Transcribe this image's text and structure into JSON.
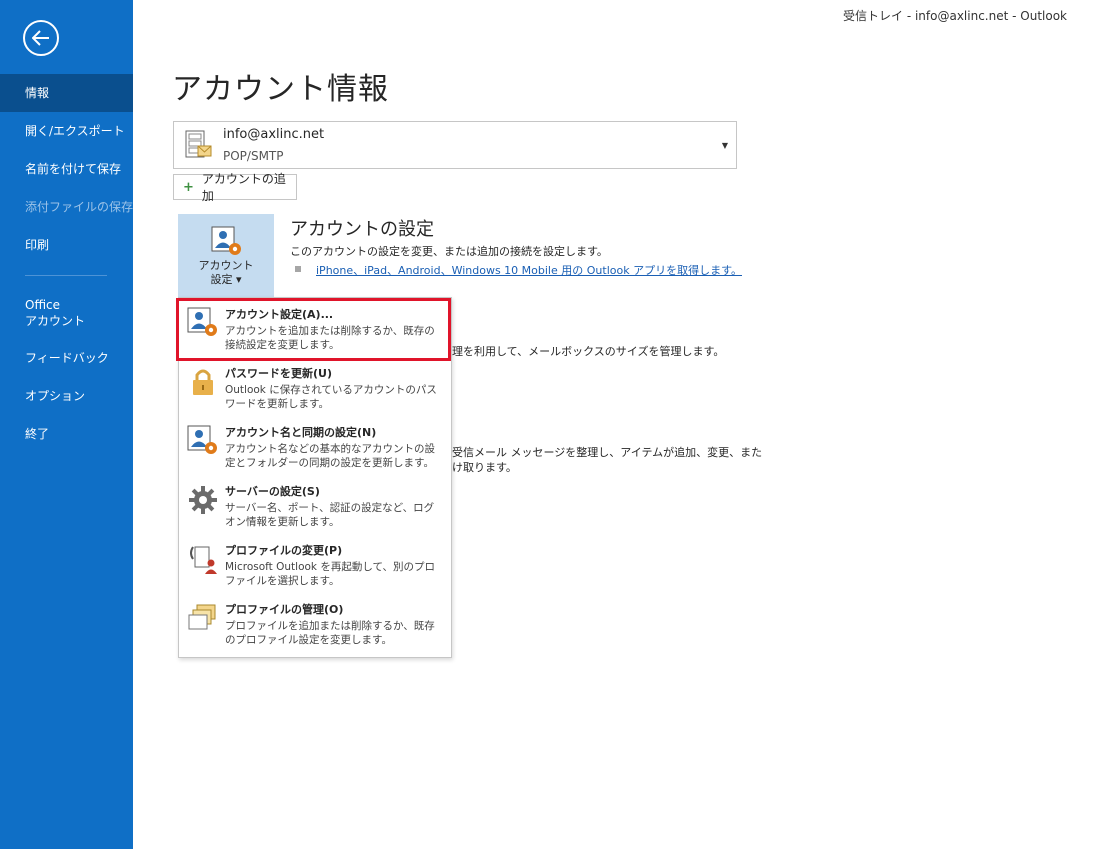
{
  "window": {
    "title": "受信トレイ - info@axlinc.net  -  Outlook"
  },
  "sidebar": {
    "items": [
      {
        "label": "情報",
        "active": true
      },
      {
        "label": "開く/エクスポート"
      },
      {
        "label": "名前を付けて保存"
      },
      {
        "label": "添付ファイルの保存",
        "disabled": true
      },
      {
        "label": "印刷"
      },
      {
        "label": "Office\nアカウント"
      },
      {
        "label": "フィードバック"
      },
      {
        "label": "オプション"
      },
      {
        "label": "終了"
      }
    ]
  },
  "main": {
    "title": "アカウント情報",
    "account": {
      "email": "info@axlinc.net",
      "type": "POP/SMTP"
    },
    "add_account_label": "アカウントの追加",
    "settings_button_label": "アカウント\n設定 ▾",
    "section": {
      "title": "アカウントの設定",
      "description": "このアカウントの設定を変更、または追加の接続を設定します。",
      "link": "iPhone、iPad、Android、Windows 10 Mobile 用の Outlook アプリを取得します。"
    },
    "partial_text": [
      "理を利用して、メールボックスのサイズを管理します。",
      "受信メール メッセージを整理し、アイテムが追加、変更、また",
      "け取ります。"
    ]
  },
  "menu": {
    "items": [
      {
        "title": "アカウント設定(A)...",
        "desc": "アカウントを追加または削除するか、既存の接続設定を変更します。",
        "icon": "account-settings-icon"
      },
      {
        "title": "パスワードを更新(U)",
        "desc": "Outlook に保存されているアカウントのパスワードを更新します。",
        "icon": "lock-icon"
      },
      {
        "title": "アカウント名と同期の設定(N)",
        "desc": "アカウント名などの基本的なアカウントの設定とフォルダーの同期の設定を更新します。",
        "icon": "account-sync-icon"
      },
      {
        "title": "サーバーの設定(S)",
        "desc": "サーバー名、ポート、認証の設定など、ログオン情報を更新します。",
        "icon": "gear-icon"
      },
      {
        "title": "プロファイルの変更(P)",
        "desc": "Microsoft Outlook を再起動して、別のプロファイルを選択します。",
        "icon": "profile-switch-icon"
      },
      {
        "title": "プロファイルの管理(O)",
        "desc": "プロファイルを追加または削除するか、既存のプロファイル設定を変更します。",
        "icon": "profile-manage-icon"
      }
    ]
  },
  "colors": {
    "sidebar": "#0f6fc6",
    "sidebar_active": "#0a4f8e",
    "highlight": "#e0142a",
    "link": "#1a5fb4"
  }
}
